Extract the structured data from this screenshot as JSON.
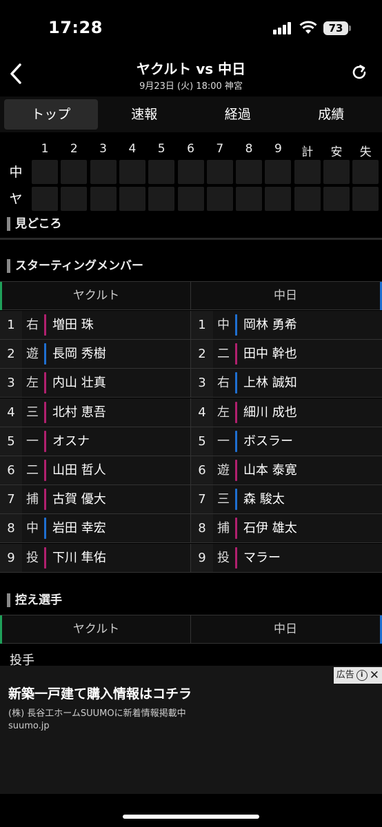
{
  "status_bar": {
    "time": "17:28",
    "battery": "73"
  },
  "header": {
    "title": "ヤクルト vs 中日",
    "subtitle": "9月23日 (火) 18:00 神宮"
  },
  "tabs": [
    "トップ",
    "速報",
    "経過",
    "成績"
  ],
  "scoreboard": {
    "columns": [
      "1",
      "2",
      "3",
      "4",
      "5",
      "6",
      "7",
      "8",
      "9",
      "計",
      "安",
      "失"
    ],
    "rows": [
      {
        "team": "中",
        "cells": [
          "",
          "",
          "",
          "",
          "",
          "",
          "",
          "",
          "",
          "",
          "",
          ""
        ]
      },
      {
        "team": "ヤ",
        "cells": [
          "",
          "",
          "",
          "",
          "",
          "",
          "",
          "",
          "",
          "",
          "",
          ""
        ]
      }
    ]
  },
  "sections": {
    "highlights": "見どころ",
    "starting": "スターティングメンバー",
    "bench": "控え選手"
  },
  "teams": {
    "home": "ヤクルト",
    "away": "中日"
  },
  "lineup": {
    "home": [
      {
        "order": "1",
        "pos": "右",
        "name": "増田 珠",
        "bar": "#b0206e"
      },
      {
        "order": "2",
        "pos": "遊",
        "name": "長岡 秀樹",
        "bar": "#1f6fd0"
      },
      {
        "order": "3",
        "pos": "左",
        "name": "内山 壮真",
        "bar": "#b0206e"
      },
      {
        "order": "4",
        "pos": "三",
        "name": "北村 恵吾",
        "bar": "#b0206e"
      },
      {
        "order": "5",
        "pos": "一",
        "name": "オスナ",
        "bar": "#b0206e"
      },
      {
        "order": "6",
        "pos": "二",
        "name": "山田 哲人",
        "bar": "#b0206e"
      },
      {
        "order": "7",
        "pos": "捕",
        "name": "古賀 優大",
        "bar": "#b0206e"
      },
      {
        "order": "8",
        "pos": "中",
        "name": "岩田 幸宏",
        "bar": "#1f6fd0"
      },
      {
        "order": "9",
        "pos": "投",
        "name": "下川 隼佑",
        "bar": "#b0206e"
      }
    ],
    "away": [
      {
        "order": "1",
        "pos": "中",
        "name": "岡林 勇希",
        "bar": "#1f6fd0"
      },
      {
        "order": "2",
        "pos": "二",
        "name": "田中 幹也",
        "bar": "#b0206e"
      },
      {
        "order": "3",
        "pos": "右",
        "name": "上林 誠知",
        "bar": "#1f6fd0"
      },
      {
        "order": "4",
        "pos": "左",
        "name": "細川 成也",
        "bar": "#b0206e"
      },
      {
        "order": "5",
        "pos": "一",
        "name": "ボスラー",
        "bar": "#1f6fd0"
      },
      {
        "order": "6",
        "pos": "遊",
        "name": "山本 泰寛",
        "bar": "#b0206e"
      },
      {
        "order": "7",
        "pos": "三",
        "name": "森 駿太",
        "bar": "#1f6fd0"
      },
      {
        "order": "8",
        "pos": "捕",
        "name": "石伊 雄太",
        "bar": "#b0206e"
      },
      {
        "order": "9",
        "pos": "投",
        "name": "マラー",
        "bar": "#b0206e"
      }
    ]
  },
  "bench": {
    "category": "投手"
  },
  "ad": {
    "badge": "広告",
    "title": "新築一戸建て購入情報はコチラ",
    "description": "(株) 長谷工ホームSUUMOに新着情報掲載中",
    "domain": "suumo.jp"
  }
}
